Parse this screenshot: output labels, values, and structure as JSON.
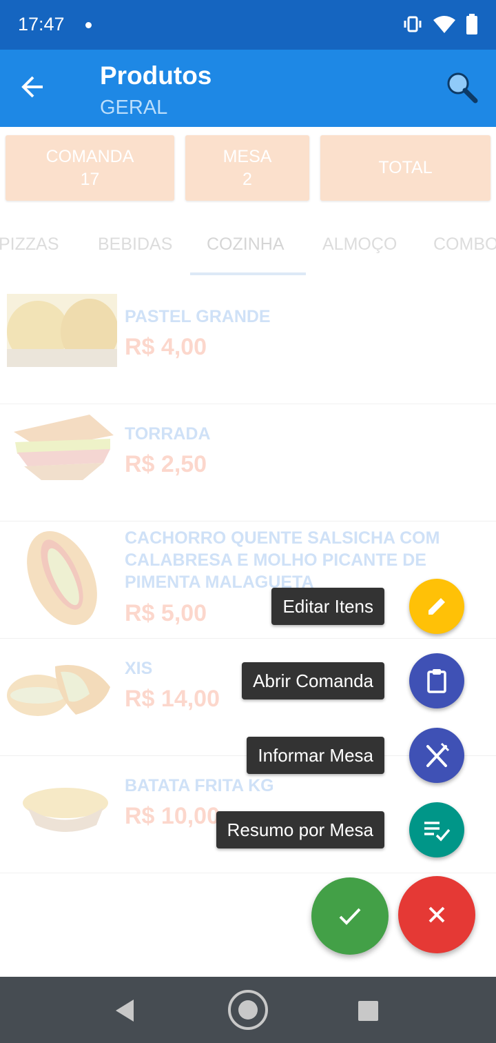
{
  "status_bar": {
    "time": "17:47"
  },
  "app_bar": {
    "title": "Produtos",
    "subtitle": "GERAL"
  },
  "summary": {
    "comanda_label": "COMANDA",
    "comanda_value": "17",
    "mesa_label": "MESA",
    "mesa_value": "2",
    "total_label": "TOTAL"
  },
  "tabs": [
    "PIZZAS",
    "BEBIDAS",
    "COZINHA",
    "ALMOÇO",
    "COMBO"
  ],
  "products": [
    {
      "name": "PASTEL GRANDE",
      "price": "R$ 4,00"
    },
    {
      "name": "TORRADA",
      "price": "R$ 2,50"
    },
    {
      "name": "CACHORRO QUENTE SALSICHA COM CALABRESA E MOLHO PICANTE DE PIMENTA MALAGUETA",
      "price": "R$ 5,00"
    },
    {
      "name": "XIS",
      "price": "R$ 14,00"
    },
    {
      "name": "BATATA FRITA KG",
      "price": "R$ 10,00"
    }
  ],
  "fab_menu": [
    {
      "label": "Editar Itens",
      "icon": "pencil-icon",
      "color": "#ffc107"
    },
    {
      "label": "Abrir Comanda",
      "icon": "clipboard-icon",
      "color": "#3f51b5"
    },
    {
      "label": "Informar Mesa",
      "icon": "fork-knife-icon",
      "color": "#3f51b5"
    },
    {
      "label": "Resumo por Mesa",
      "icon": "checklist-icon",
      "color": "#009688"
    }
  ],
  "actions": {
    "confirm_color": "#43a047",
    "cancel_color": "#e53935"
  }
}
